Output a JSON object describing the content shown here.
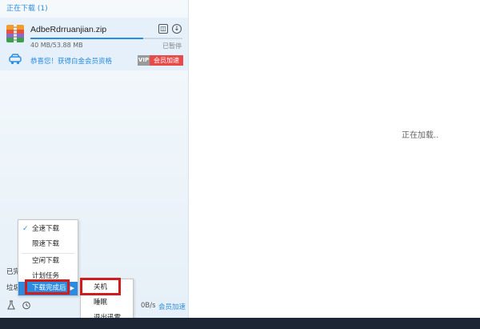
{
  "header": {
    "title": "正在下载 (1)"
  },
  "task": {
    "filename": "AdbeRdrruanjian.zip",
    "size": "40 MB/53.88 MB",
    "status": "已暂停",
    "progress": 0.74,
    "promo": "恭喜您！获得白金会员资格",
    "vip_tag": "VIP",
    "vip_button": "会员加速"
  },
  "main": {
    "loading": "正在加载.."
  },
  "peek": {
    "line1": "已完",
    "line2": "垃圾"
  },
  "menu": {
    "items": [
      {
        "label": "全速下载",
        "checked": true
      },
      {
        "label": "限速下载"
      },
      {
        "label": "空闲下载"
      },
      {
        "label": "计划任务"
      },
      {
        "label": "下载完成后"
      }
    ]
  },
  "submenu": {
    "items": [
      {
        "label": "关机"
      },
      {
        "label": "睡眠"
      },
      {
        "label": "退出迅雷"
      }
    ]
  },
  "bottom": {
    "speed": "0B/s",
    "speedup": "会员加速"
  },
  "colors": {
    "accent": "#2a8be0",
    "highlight": "#d11c1c",
    "vip": "#e84a4a"
  }
}
